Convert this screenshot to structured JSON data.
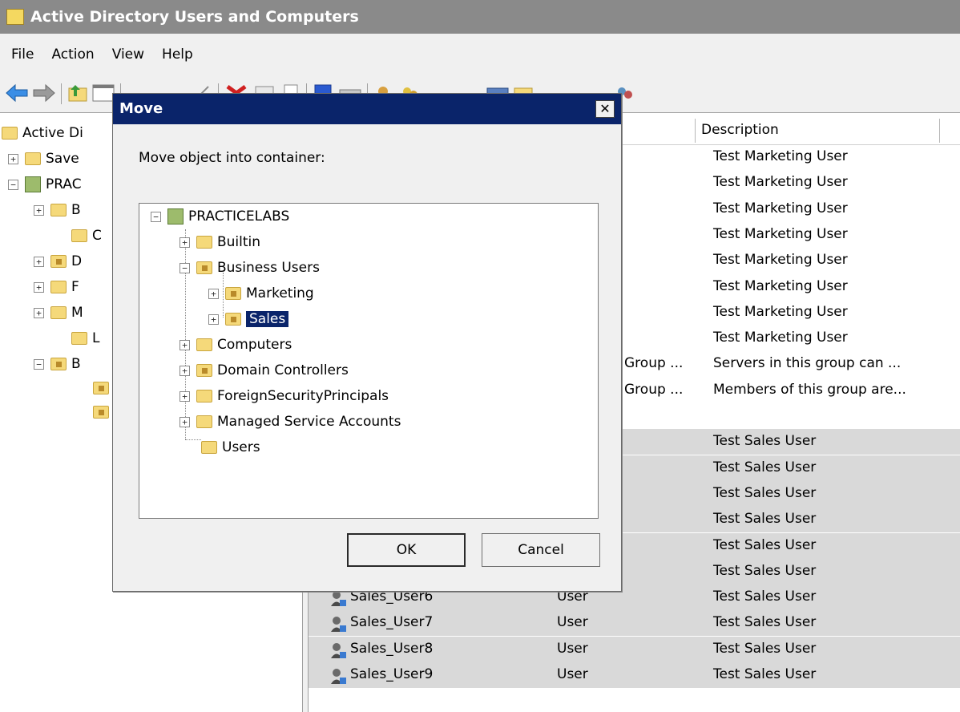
{
  "window": {
    "title": "Active Directory Users and Computers"
  },
  "menu": [
    "File",
    "Action",
    "View",
    "Help"
  ],
  "left_tree": [
    {
      "label": "Active Di",
      "expander": ""
    },
    {
      "label": "Save",
      "expander": "+"
    },
    {
      "label": "PRAC",
      "expander": "−"
    },
    {
      "label": "B",
      "expander": "+"
    },
    {
      "label": "C",
      "expander": ""
    },
    {
      "label": "D",
      "expander": "+"
    },
    {
      "label": "F",
      "expander": "+"
    },
    {
      "label": "M",
      "expander": "+"
    },
    {
      "label": "L",
      "expander": ""
    },
    {
      "label": "B",
      "expander": "−"
    }
  ],
  "list": {
    "column_description": "Description",
    "rows": [
      {
        "name": "",
        "type": "",
        "description": "Test Marketing User"
      },
      {
        "name": "",
        "type": "",
        "description": "Test Marketing User"
      },
      {
        "name": "",
        "type": "",
        "description": "Test Marketing User"
      },
      {
        "name": "",
        "type": "",
        "description": "Test Marketing User"
      },
      {
        "name": "",
        "type": "",
        "description": "Test Marketing User"
      },
      {
        "name": "",
        "type": "",
        "description": "Test Marketing User"
      },
      {
        "name": "",
        "type": "",
        "description": "Test Marketing User"
      },
      {
        "name": "",
        "type": "",
        "description": "Test Marketing User"
      },
      {
        "name": "",
        "type": "Group ...",
        "description": "Servers in this group can ..."
      },
      {
        "name": "",
        "type": "Group ...",
        "description": "Members of this group are..."
      },
      {
        "name": "",
        "type": "",
        "description": ""
      },
      {
        "name": "",
        "type": "",
        "description": "Test Sales User"
      },
      {
        "name": "",
        "type": "",
        "description": "Test Sales User"
      },
      {
        "name": "",
        "type": "",
        "description": "Test Sales User"
      },
      {
        "name": "",
        "type": "",
        "description": "Test Sales User"
      },
      {
        "name": "",
        "type": "",
        "description": "Test Sales User"
      },
      {
        "name": "",
        "type": "",
        "description": "Test Sales User"
      },
      {
        "name": "Sales_User6",
        "type": "User",
        "description": "Test Sales User"
      },
      {
        "name": "Sales_User7",
        "type": "User",
        "description": "Test Sales User"
      },
      {
        "name": "Sales_User8",
        "type": "User",
        "description": "Test Sales User"
      },
      {
        "name": "Sales_User9",
        "type": "User",
        "description": "Test Sales User"
      }
    ]
  },
  "dialog": {
    "title": "Move",
    "close": "✕",
    "prompt": "Move object into container:",
    "tree": {
      "root": "PRACTICELABS",
      "items": [
        "Builtin",
        "Business Users",
        "Marketing",
        "Sales",
        "Computers",
        "Domain Controllers",
        "ForeignSecurityPrincipals",
        "Managed Service Accounts",
        "Users"
      ]
    },
    "ok_label": "OK",
    "cancel_label": "Cancel"
  }
}
